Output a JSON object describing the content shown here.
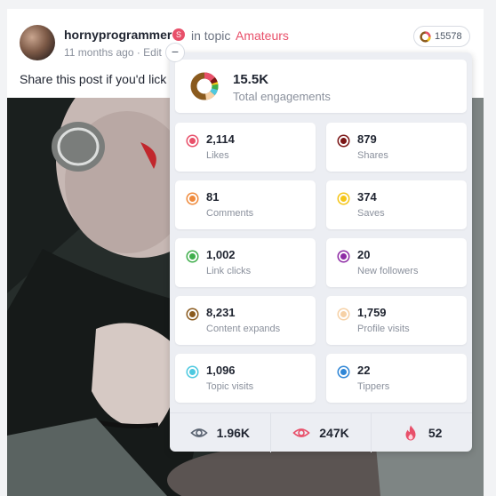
{
  "post": {
    "username": "hornyprogrammer",
    "badge_glyph": "S",
    "in_topic_text": "in topic",
    "topic": "Amateurs",
    "meta": "11 months ago · Edit",
    "text": "Share this post if you'd lick",
    "engagement_count": "15578",
    "collapse_glyph": "−"
  },
  "stats": {
    "total_value": "15.5K",
    "total_label": "Total engagements",
    "items": [
      {
        "value": "2,114",
        "label": "Likes",
        "color": "#e8506a"
      },
      {
        "value": "879",
        "label": "Shares",
        "color": "#7a1515"
      },
      {
        "value": "81",
        "label": "Comments",
        "color": "#ef8a3c"
      },
      {
        "value": "374",
        "label": "Saves",
        "color": "#f5c518"
      },
      {
        "value": "1,002",
        "label": "Link clicks",
        "color": "#3fae4b"
      },
      {
        "value": "20",
        "label": "New followers",
        "color": "#8e2ba5"
      },
      {
        "value": "8,231",
        "label": "Content expands",
        "color": "#8a5a1e"
      },
      {
        "value": "1,759",
        "label": "Profile visits",
        "color": "#f6d1a6"
      },
      {
        "value": "1,096",
        "label": "Topic visits",
        "color": "#4dc9e0"
      },
      {
        "value": "22",
        "label": "Tippers",
        "color": "#2f86d6"
      }
    ],
    "footer": {
      "views_value": "1.96K",
      "reach_value": "247K",
      "hot_value": "52"
    }
  },
  "icons": {
    "collapse": "minus-icon",
    "views": "eye-icon",
    "reach": "eye-icon",
    "hot": "flame-icon",
    "badge": "star-badge-icon",
    "engagement": "donut-ring-icon"
  }
}
